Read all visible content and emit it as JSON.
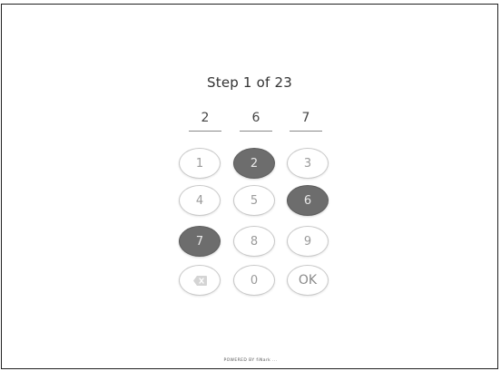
{
  "step": {
    "label": "Step 1 of 23"
  },
  "entered_digits": [
    "2",
    "6",
    "7"
  ],
  "keypad": {
    "keys": [
      {
        "label": "1",
        "selected": false
      },
      {
        "label": "2",
        "selected": true
      },
      {
        "label": "3",
        "selected": false
      },
      {
        "label": "4",
        "selected": false
      },
      {
        "label": "5",
        "selected": false
      },
      {
        "label": "6",
        "selected": true
      },
      {
        "label": "7",
        "selected": true
      },
      {
        "label": "8",
        "selected": false
      },
      {
        "label": "9",
        "selected": false
      }
    ],
    "backspace_icon": "backspace-icon",
    "zero_label": "0",
    "ok_label": "OK"
  },
  "footer": {
    "powered_by": "POWERED BY fiNark ..."
  },
  "colors": {
    "selected_key": "#6d6d6d",
    "key_border": "#c9c9c9",
    "key_text": "#9a9a9a"
  }
}
